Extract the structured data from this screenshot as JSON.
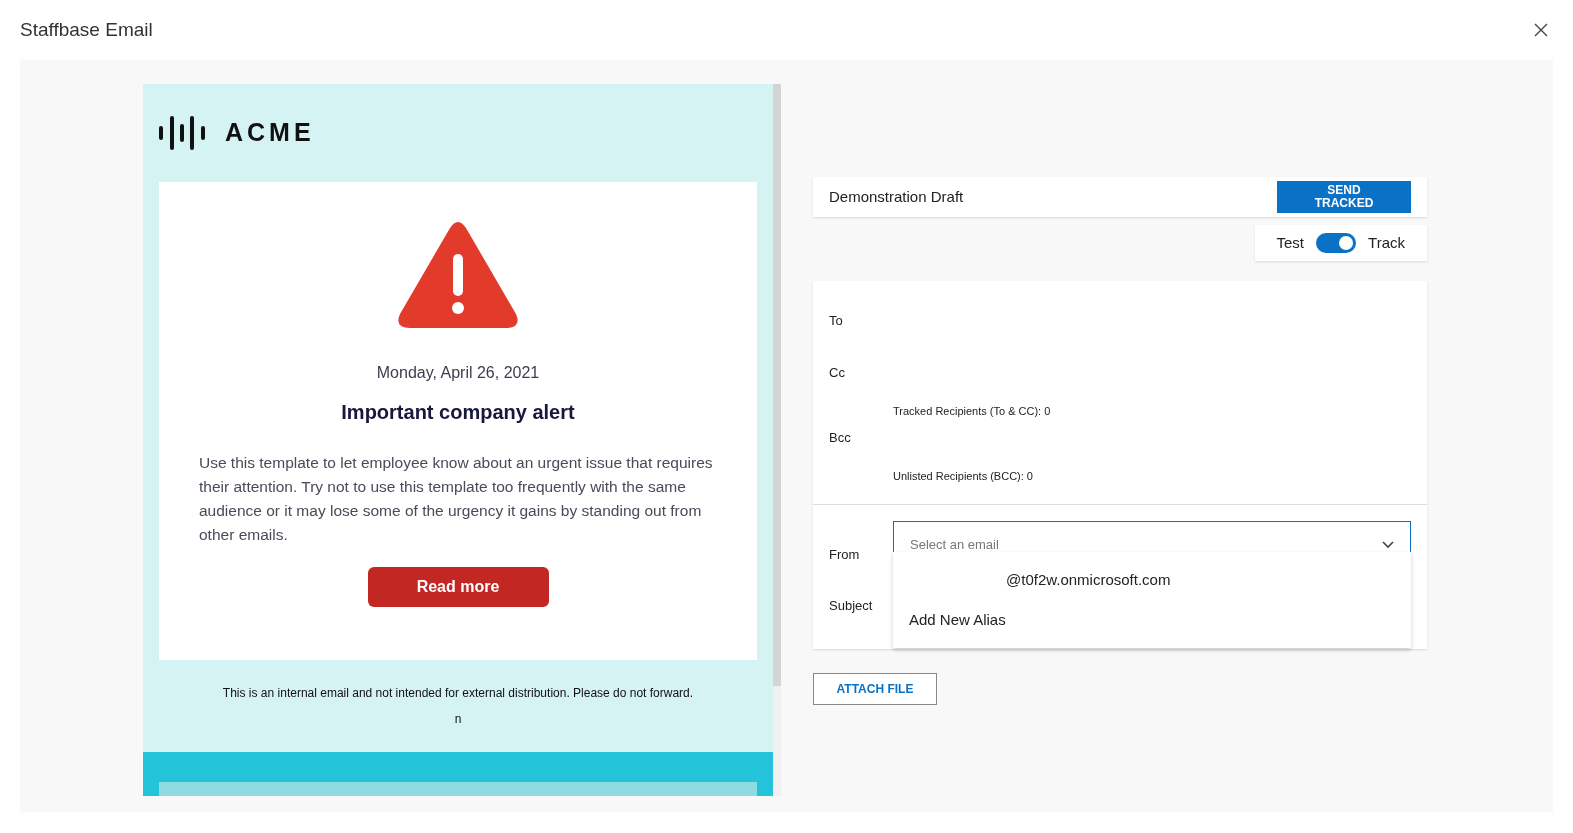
{
  "window": {
    "title": "Staffbase Email"
  },
  "email": {
    "logo_text": "ACME",
    "date": "Monday, April 26, 2021",
    "headline": "Important company alert",
    "body": "Use this template to let employee know about an urgent issue that requires their attention. Try not to use this template too frequently with the same audience or it may lose some of the urgency it gains by standing out from other emails.",
    "button": "Read more",
    "footer": "This is an internal email and not intended for external distribution. Please do not forward.",
    "footer_note": "n"
  },
  "draft": {
    "name": "Demonstration Draft",
    "send_button": "SEND TRACKED"
  },
  "mode_toggle": {
    "left_label": "Test",
    "right_label": "Track",
    "on": true
  },
  "recipients": [
    {
      "label": "To"
    },
    {
      "label": "Cc",
      "note": "Tracked Recipients (To & CC): 0"
    },
    {
      "label": "Bcc",
      "note": "Unlisted Recipients (BCC): 0"
    }
  ],
  "from": {
    "label": "From",
    "placeholder": "Select an email",
    "options": [
      "@t0f2w.onmicrosoft.com",
      "Add New Alias"
    ]
  },
  "subject": {
    "label": "Subject"
  },
  "attach_button": "ATTACH FILE"
}
